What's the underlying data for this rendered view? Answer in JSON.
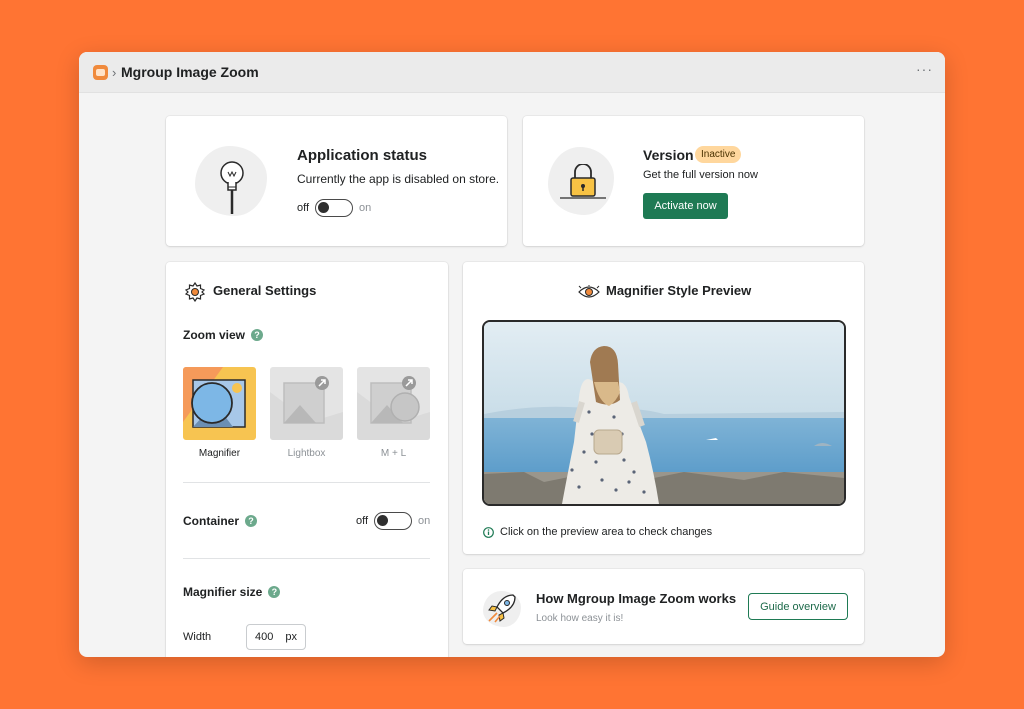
{
  "titlebar": {
    "breadcrumb_sep": "›",
    "app_title": "Mgroup Image Zoom",
    "more_label": "···"
  },
  "app_status": {
    "title": "Application status",
    "description": "Currently the app is disabled on store.",
    "toggle_off": "off",
    "toggle_on": "on",
    "enabled": false
  },
  "version": {
    "title": "Version",
    "badge": "Inactive",
    "description": "Get the full version now",
    "button": "Activate now"
  },
  "general_settings": {
    "title": "General Settings",
    "zoom_view": {
      "label": "Zoom view",
      "help": "?",
      "options": [
        {
          "label": "Magnifier",
          "selected": true
        },
        {
          "label": "Lightbox",
          "selected": false
        },
        {
          "label": "M + L",
          "selected": false
        }
      ]
    },
    "container": {
      "label": "Container",
      "help": "?",
      "toggle_off": "off",
      "toggle_on": "on",
      "enabled": false
    },
    "magnifier_size": {
      "label": "Magnifier size",
      "help": "?",
      "width_label": "Width",
      "width_value": "400",
      "width_unit": "px"
    }
  },
  "preview": {
    "title": "Magnifier Style Preview",
    "hint": "Click on the preview area to check changes"
  },
  "how_it_works": {
    "title": "How Mgroup Image Zoom works",
    "subtitle": "Look how easy it is!",
    "button": "Guide overview"
  },
  "colors": {
    "page_background": "#FF7433",
    "primary_button": "#1E7A54",
    "badge_background": "#FFD79D",
    "help_icon": "#6CA98C"
  },
  "icons": {
    "app": "app-logo-icon",
    "status": "lightbulb-icon",
    "version": "padlock-icon",
    "settings": "gear-icon",
    "preview": "eye-icon",
    "hint": "info-icon",
    "guide": "rocket-icon",
    "open": "expand-arrow-icon"
  }
}
